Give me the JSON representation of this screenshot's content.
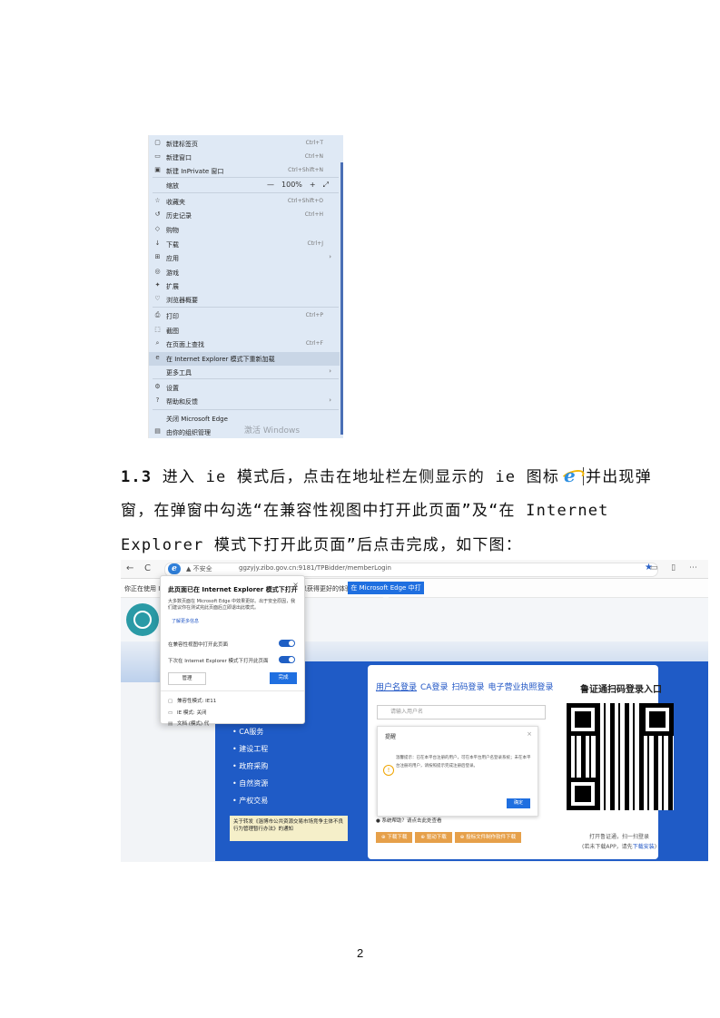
{
  "menu": {
    "items": [
      {
        "icon": "new-tab-icon",
        "glyph": "▢",
        "label": "新建标签页",
        "shortcut": "Ctrl+T"
      },
      {
        "icon": "new-window-icon",
        "glyph": "▭",
        "label": "新建窗口",
        "shortcut": "Ctrl+N"
      },
      {
        "icon": "inprivate-icon",
        "glyph": "▣",
        "label": "新建 InPrivate 窗口",
        "shortcut": "Ctrl+Shift+N"
      },
      {
        "icon": "zoom-icon",
        "glyph": "",
        "label": "缩放",
        "shortcut": ""
      },
      {
        "icon": "favorites-icon",
        "glyph": "☆",
        "label": "收藏夹",
        "shortcut": "Ctrl+Shift+O"
      },
      {
        "icon": "history-icon",
        "glyph": "↺",
        "label": "历史记录",
        "shortcut": "Ctrl+H"
      },
      {
        "icon": "shopping-icon",
        "glyph": "◇",
        "label": "购物",
        "shortcut": ""
      },
      {
        "icon": "download-icon",
        "glyph": "↓",
        "label": "下载",
        "shortcut": "Ctrl+J"
      },
      {
        "icon": "apps-icon",
        "glyph": "⊞",
        "label": "应用",
        "shortcut": ""
      },
      {
        "icon": "games-icon",
        "glyph": "◎",
        "label": "游戏",
        "shortcut": ""
      },
      {
        "icon": "extensions-icon",
        "glyph": "✦",
        "label": "扩展",
        "shortcut": ""
      },
      {
        "icon": "browser-essentials-icon",
        "glyph": "♡",
        "label": "浏览器概要",
        "shortcut": ""
      },
      {
        "icon": "print-icon",
        "glyph": "⎙",
        "label": "打印",
        "shortcut": "Ctrl+P"
      },
      {
        "icon": "screenshot-icon",
        "glyph": "⬚",
        "label": "截图",
        "shortcut": ""
      },
      {
        "icon": "find-icon",
        "glyph": "⌕",
        "label": "在页面上查找",
        "shortcut": "Ctrl+F"
      },
      {
        "icon": "ie-mode-icon",
        "glyph": "e",
        "label": "在 Internet Explorer 模式下重新加载",
        "shortcut": ""
      },
      {
        "icon": "more-tools-icon",
        "glyph": "",
        "label": "更多工具",
        "shortcut": ""
      },
      {
        "icon": "settings-icon",
        "glyph": "⚙",
        "label": "设置",
        "shortcut": ""
      },
      {
        "icon": "help-icon",
        "glyph": "?",
        "label": "帮助和反馈",
        "shortcut": ""
      },
      {
        "icon": "close-edge-icon",
        "glyph": "",
        "label": "关闭 Microsoft Edge",
        "shortcut": ""
      },
      {
        "icon": "org-managed-icon",
        "glyph": "▤",
        "label": "由你的组织管理",
        "shortcut": ""
      }
    ],
    "zoom_minus": "—",
    "zoom_value": "100%",
    "zoom_plus": "+",
    "zoom_expand": "⤢",
    "watermark": "激活 Windows"
  },
  "paragraph": {
    "num": "1.3",
    "line1_a": "进入 ie 模式后，点击在地址栏左侧显示的 ie 图标",
    "line1_b": "并出现弹",
    "line2": "窗，在弹窗中勾选“在兼容性视图中打开此页面”及“在 Internet",
    "line3": "Explorer 模式下打开此页面”后点击完成，如下图："
  },
  "browser": {
    "nav_back": "←",
    "nav_refresh": "C",
    "not_secure": "▲ 不安全",
    "url": "ggzyjy.zibo.gov.cn:9181/TPBidder/memberLogin",
    "star": "★",
    "tools": "▭ ▯ ⋯",
    "infobar_text": "你正在使用 Internet Explorer 模式浏览，",
    "infobar_text2": "以获得更好的体验。",
    "open_in_edge": "在 Microsoft Edge 中打开"
  },
  "popup": {
    "title": "此页面已在 Internet Explorer 模式下打开",
    "desc": "大多数页面在 Microsoft Edge 中效果更好。出于安全原因，我们建议你在测试完此页面后立即退出此模式。",
    "learn_more": "了解更多信息",
    "toggle1": "在兼容性视图中打开此页面",
    "toggle2": "下次在 Internet Explorer 模式下打开此页面",
    "manage": "管理",
    "done": "完成",
    "info1": "兼容性模式: IE11",
    "info2": "IE 模式: 关闭",
    "info3": "文档 (模式) 代"
  },
  "site": {
    "tabs": [
      "用户名登录",
      "CA登录",
      "扫码登录",
      "电子营业执照登录"
    ],
    "user_placeholder": "请输入用户名",
    "qr_title": "鲁证通扫码登录入口",
    "qr_note1": "打开鲁证通，扫一扫登录",
    "qr_note2_a": "(若未下载APP，请先",
    "qr_note2_link": "下载安装",
    "qr_note2_b": ")",
    "side_links": [
      "• CA服务",
      "• 建设工程",
      "• 政府采购",
      "• 自然资源",
      "• 产权交易"
    ],
    "banner": "关于转发《淄博市公共资源交易市场竞争主体不良行为管理暂行办法》的通知",
    "alert_title": "提醒",
    "alert_close": "×",
    "alert_msg": "温馨提示：已在本平台注册的用户，可在本平台用户名登录系统；未在本平台注册的用户，请按照提示完成注册后登录。",
    "alert_ok": "确定",
    "download_hint": "● 系统帮助？请点击此处查看",
    "download_btns": [
      "⊕ 下载下载",
      "⊕ 驱动下载",
      "⊕ 投标文件制作软件下载"
    ]
  },
  "page_number": "2"
}
